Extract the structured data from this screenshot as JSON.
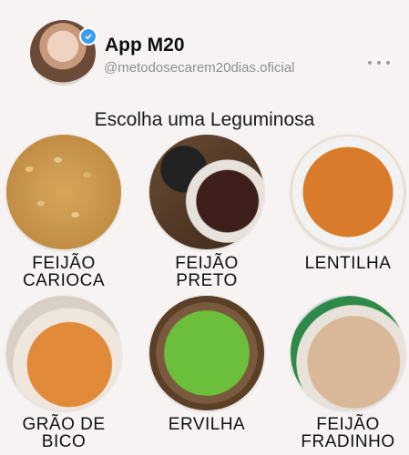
{
  "profile": {
    "app_name": "App M20",
    "handle": "@metodosecarem20dias.oficial"
  },
  "section_title": "Escolha uma Leguminosa",
  "items": [
    {
      "line1": "FEIJÃO",
      "line2": "CARIOCA"
    },
    {
      "line1": "FEIJÃO",
      "line2": "PRETO"
    },
    {
      "line1": "LENTILHA",
      "line2": ""
    },
    {
      "line1": "GRÃO DE",
      "line2": "BICO"
    },
    {
      "line1": "ERVILHA",
      "line2": ""
    },
    {
      "line1": "FEIJÃO",
      "line2": "FRADINHO"
    }
  ],
  "icons": {
    "verified": "verified-check-icon",
    "more": "more-options-icon"
  },
  "colors": {
    "background": "#f7f3f2",
    "verified": "#3a9cf0",
    "handle": "#8f8f8f"
  }
}
